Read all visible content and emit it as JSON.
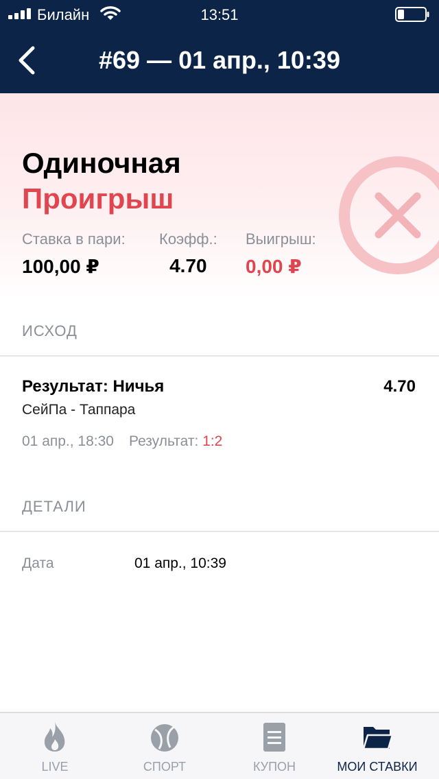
{
  "status_bar": {
    "carrier": "Билайн",
    "time": "13:51"
  },
  "nav": {
    "title": "#69 — 01 апр., 10:39",
    "back_icon": "chevron-left-icon"
  },
  "bet": {
    "type": "Одиночная",
    "status": "Проигрыш",
    "status_icon": "close-circle-icon",
    "stake_label": "Ставка в пари:",
    "stake_value": "100,00 ₽",
    "odds_label": "Коэфф.:",
    "odds_value": "4.70",
    "payout_label": "Выигрыш:",
    "payout_value": "0,00 ₽"
  },
  "outcome_section": {
    "header": "ИСХОД",
    "name": "Результат: Ничья",
    "odd": "4.70",
    "event": "СейПа - Таппара",
    "datetime": "01 апр., 18:30",
    "result_label": "Результат:",
    "result_score": "1:2"
  },
  "details_section": {
    "header": "ДЕТАЛИ",
    "date_label": "Дата",
    "date_value": "01 апр., 10:39"
  },
  "tabs": [
    {
      "label": "LIVE",
      "icon": "flame-icon"
    },
    {
      "label": "СПОРТ",
      "icon": "ball-icon"
    },
    {
      "label": "КУПОН",
      "icon": "coupon-icon"
    },
    {
      "label": "МОИ СТАВКИ",
      "icon": "folder-icon"
    }
  ],
  "colors": {
    "navy": "#0c2448",
    "loss_red": "#e0464f",
    "muted_gray": "#8a8f98"
  }
}
